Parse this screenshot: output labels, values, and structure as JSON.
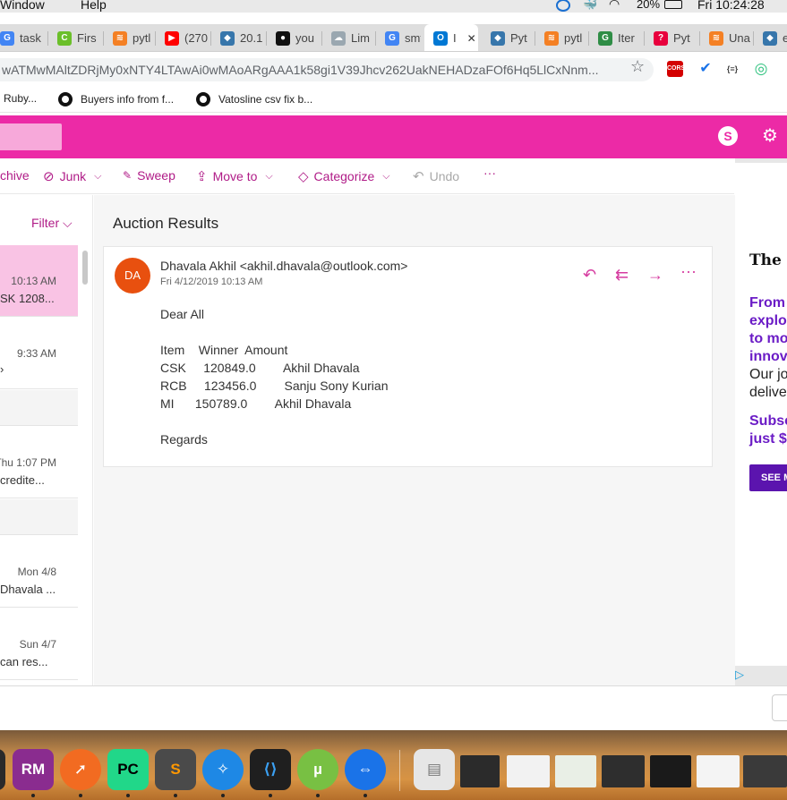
{
  "menubar": {
    "items": [
      "Window",
      "Help"
    ],
    "battery": "20%",
    "clock": "Fri 10:24:28"
  },
  "tabs": [
    {
      "label": "task",
      "color": "#4285f4",
      "glyph": "G"
    },
    {
      "label": "Firs",
      "color": "#6bbf2a",
      "glyph": "C"
    },
    {
      "label": "pytl",
      "color": "#f48024",
      "glyph": "≋"
    },
    {
      "label": "(270",
      "color": "#ff0000",
      "glyph": "▶"
    },
    {
      "label": "20.1",
      "color": "#3776ab",
      "glyph": "◆"
    },
    {
      "label": "you",
      "color": "#111111",
      "glyph": "●"
    },
    {
      "label": "Lim",
      "color": "#9aa7b0",
      "glyph": "☁"
    },
    {
      "label": "smt",
      "color": "#4285f4",
      "glyph": "G"
    },
    {
      "label": "I",
      "color": "#0078d4",
      "glyph": "O"
    },
    {
      "label": "Pyt",
      "color": "#3776ab",
      "glyph": "◆"
    },
    {
      "label": "pytl",
      "color": "#f48024",
      "glyph": "≋"
    },
    {
      "label": "Iter",
      "color": "#2f8d46",
      "glyph": "G"
    },
    {
      "label": "Pyt",
      "color": "#e8003d",
      "glyph": "?"
    },
    {
      "label": "Una",
      "color": "#f48024",
      "glyph": "≋"
    },
    {
      "label": "em",
      "color": "#3776ab",
      "glyph": "◆"
    }
  ],
  "active_tab_close": "✕",
  "address": {
    "url": "wATMwMAltZDRjMy0xNTY4LTAwAi0wMAoARgAAA1k58gi1V39Jhcv262UakNEHADzaFOf6Hq5LlCxNnm..."
  },
  "extensions": [
    {
      "name": "cors-extension",
      "label": "CORS",
      "color": "#d40000"
    },
    {
      "name": "checkmark-extension",
      "label": "✔",
      "color": "#1a73e8"
    },
    {
      "name": "json-extension",
      "label": "{≡}",
      "color": "#444444"
    },
    {
      "name": "circle-extension",
      "label": "◎",
      "color": "#2ec27e"
    }
  ],
  "bookmarks": [
    {
      "label": "Ruby..."
    },
    {
      "label": "Buyers info from f..."
    },
    {
      "label": "Vatosline csv fix b..."
    }
  ],
  "commands": [
    {
      "label": "chive",
      "icon": ""
    },
    {
      "label": "Junk",
      "icon": "⊘"
    },
    {
      "label": "Sweep",
      "icon": "🧹"
    },
    {
      "label": "Move to",
      "icon": "⇪"
    },
    {
      "label": "Categorize",
      "icon": "◇"
    },
    {
      "label": "Undo",
      "icon": "↶"
    },
    {
      "label": "···",
      "icon": ""
    }
  ],
  "msglist": {
    "filter": "Filter ⌵",
    "items": [
      {
        "time": "10:13 AM",
        "snippet": "SK 1208..."
      },
      {
        "time": "9:33 AM",
        "snippet": "›"
      },
      {
        "time": "",
        "snippet": ""
      },
      {
        "time": "Thu 1:07 PM",
        "snippet": "credite..."
      },
      {
        "time": "",
        "snippet": ""
      },
      {
        "time": "Mon 4/8",
        "snippet": "Dhavala ..."
      },
      {
        "time": "Sun 4/7",
        "snippet": "can res..."
      }
    ]
  },
  "email": {
    "subject": "Auction Results",
    "avatar": "DA",
    "from": "Dhavala Akhil <akhil.dhavala@outlook.com>",
    "date": "Fri 4/12/2019 10:13 AM",
    "greeting": "Dear All",
    "table_header": "Item    Winner  Amount",
    "rows": [
      "CSK     120849.0        Akhil Dhavala",
      "RCB     123456.0        Sanju Sony Kurian",
      "MI      150789.0        Akhil Dhavala"
    ],
    "closing": "Regards"
  },
  "ad": {
    "brand": "The New",
    "lines_purple": [
      "From",
      "explo",
      "to mo",
      "innov"
    ],
    "lines_black": [
      "Our jo",
      "delive"
    ],
    "subscribe": [
      "Subsc",
      "just $"
    ],
    "button": "SEE M",
    "adchoices": "▷"
  }
}
